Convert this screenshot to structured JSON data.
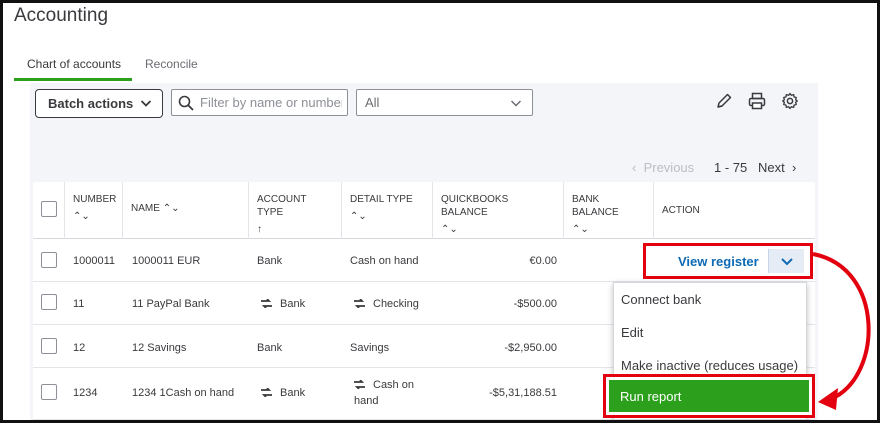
{
  "page": {
    "title": "Accounting"
  },
  "tabs": [
    {
      "label": "Chart of accounts",
      "active": true
    },
    {
      "label": "Reconcile",
      "active": false
    }
  ],
  "toolbar": {
    "batch_actions_label": "Batch actions",
    "search_placeholder": "Filter by name or number",
    "filter_value": "All",
    "icons": [
      "pencil-icon",
      "printer-icon",
      "gear-icon"
    ]
  },
  "pagination": {
    "previous": "Previous",
    "range": "1 - 75",
    "next": "Next"
  },
  "table": {
    "columns": [
      {
        "label": "NUMBER",
        "sort": "⌃⌄"
      },
      {
        "label": "NAME",
        "sort": "⌃⌄"
      },
      {
        "label": "ACCOUNT TYPE",
        "sort": "↑"
      },
      {
        "label": "DETAIL TYPE",
        "sort": "⌃⌄"
      },
      {
        "label": "QUICKBOOKS BALANCE",
        "sort": "⌃⌄"
      },
      {
        "label": "BANK BALANCE",
        "sort": "⌃⌄"
      },
      {
        "label": "ACTION",
        "sort": ""
      }
    ],
    "rows": [
      {
        "number": "1000011",
        "name": "1000011 EUR",
        "account_type": "Bank",
        "detail_type": "Cash on hand",
        "qb_balance": "€0.00",
        "bank_balance": "",
        "type_icon": false,
        "detail_icon": false
      },
      {
        "number": "11",
        "name": "11 PayPal Bank",
        "account_type": "Bank",
        "detail_type": "Checking",
        "qb_balance": "-$500.00",
        "bank_balance": "",
        "type_icon": true,
        "detail_icon": true
      },
      {
        "number": "12",
        "name": "12 Savings",
        "account_type": "Bank",
        "detail_type": "Savings",
        "qb_balance": "-$2,950.00",
        "bank_balance": "",
        "type_icon": false,
        "detail_icon": false
      },
      {
        "number": "1234",
        "name": "1234 1Cash on hand",
        "account_type": "Bank",
        "detail_type_line1": "Cash on",
        "detail_type_line2": "hand",
        "qb_balance": "-$5,31,188.51",
        "bank_balance": "",
        "type_icon": true,
        "detail_icon": true
      }
    ]
  },
  "action": {
    "view_register_label": "View register",
    "menu": [
      "Connect bank",
      "Edit",
      "Make inactive (reduces usage)",
      "Run report"
    ]
  },
  "colors": {
    "accent_green": "#2ca01c",
    "link_blue": "#0d6ab5",
    "highlight_red": "#e3000f"
  }
}
